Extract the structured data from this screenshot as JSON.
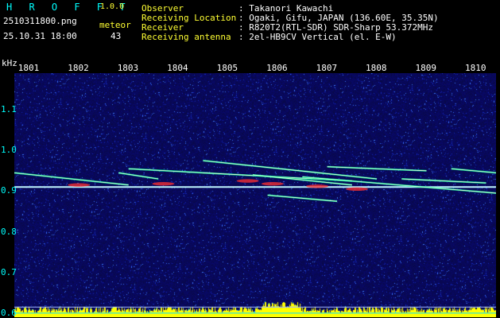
{
  "header": {
    "title": "H R O F F T",
    "version": "1.0.0",
    "filename": "2510311800.png",
    "datetime": "25.10.31 18:00",
    "meteor_label": "meteor",
    "meteor_count": "43"
  },
  "info": [
    {
      "key": "Observer",
      "value": ": Takanori Kawachi"
    },
    {
      "key": "Receiving Location",
      "value": ": Ogaki, Gifu, JAPAN (136.60E, 35.35N)"
    },
    {
      "key": "Receiver",
      "value": ": R820T2(RTL-SDR) SDR-Sharp 53.372MHz"
    },
    {
      "key": "Receiving antenna",
      "value": ": 2el-HB9CV Vertical (el. E-W)"
    }
  ],
  "colors": {
    "background": "#000000",
    "noise_base": "#0a0a5a",
    "label_cyan": "#00ffff",
    "label_yellow": "#ffff33",
    "baseline_line": "#00e0ff",
    "lower_band": "#ffff00"
  },
  "chart_data": {
    "type": "heatmap",
    "xlabel": "",
    "ylabel": "kHz",
    "x_ticks": [
      "1801",
      "1802",
      "1803",
      "1804",
      "1805",
      "1806",
      "1807",
      "1808",
      "1809",
      "1810"
    ],
    "y_ticks": [
      "1.1",
      "1.0",
      "0.9",
      "0.8",
      "0.7",
      "0.6"
    ],
    "ylim": [
      0.59,
      1.19
    ],
    "xlim": [
      1800.7,
      1810.4
    ],
    "carrier_khz": 0.91,
    "meteor_traces": [
      {
        "x": [
          1800.7,
          1803.0
        ],
        "y": [
          0.945,
          0.915
        ]
      },
      {
        "x": [
          1803.0,
          1807.5
        ],
        "y": [
          0.955,
          0.925
        ]
      },
      {
        "x": [
          1804.5,
          1808.0
        ],
        "y": [
          0.975,
          0.93
        ]
      },
      {
        "x": [
          1805.5,
          1807.5
        ],
        "y": [
          0.94,
          0.915
        ]
      },
      {
        "x": [
          1806.5,
          1810.4
        ],
        "y": [
          0.935,
          0.895
        ]
      },
      {
        "x": [
          1807.0,
          1809.0
        ],
        "y": [
          0.96,
          0.95
        ]
      },
      {
        "x": [
          1809.5,
          1810.4
        ],
        "y": [
          0.955,
          0.945
        ]
      },
      {
        "x": [
          1808.5,
          1810.2
        ],
        "y": [
          0.93,
          0.92
        ]
      },
      {
        "x": [
          1802.8,
          1803.6
        ],
        "y": [
          0.945,
          0.93
        ]
      },
      {
        "x": [
          1805.8,
          1807.2
        ],
        "y": [
          0.89,
          0.875
        ]
      }
    ]
  }
}
